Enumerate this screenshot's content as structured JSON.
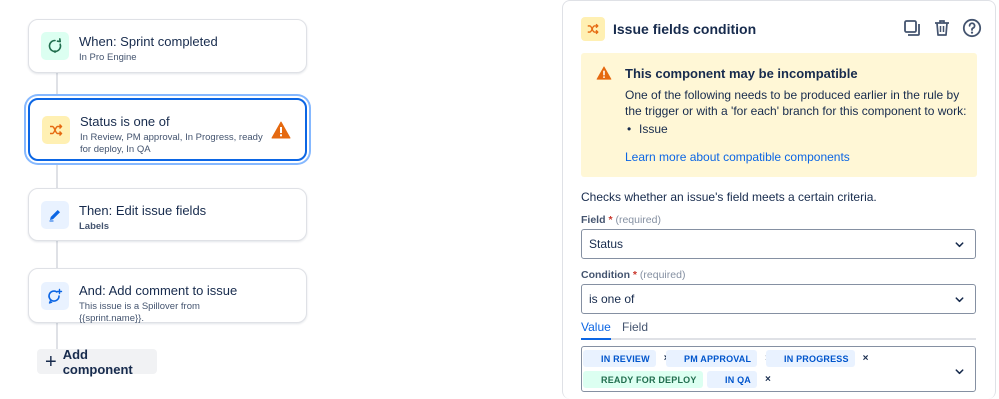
{
  "flow": {
    "trigger": {
      "title": "When: Sprint completed",
      "subtitle": "In Pro Engine",
      "icon": "sprint-refresh-icon"
    },
    "condition": {
      "title": "Status is one of",
      "subtitle": "In Review, PM approval, In Progress, ready for deploy, In QA",
      "icon": "shuffle-icon",
      "warning_icon": "warning-icon"
    },
    "action1": {
      "title": "Then: Edit issue fields",
      "subtitle": "Labels",
      "icon": "pencil-icon"
    },
    "action2": {
      "title": "And: Add comment to issue",
      "subtitle": "This issue is a Spillover from {{sprint.name}}.",
      "icon": "comment-add-icon"
    },
    "add_button": "Add component"
  },
  "panel": {
    "title": "Issue fields condition",
    "warning": {
      "title": "This component may be incompatible",
      "body": "One of the following needs to be produced earlier in the rule by the trigger or with a 'for each' branch for this component to work:",
      "bullet": "Issue",
      "link": "Learn more about compatible components"
    },
    "description": "Checks whether an issue's field meets a certain criteria.",
    "field": {
      "label": "Field",
      "required_mark": "*",
      "hint": "(required)",
      "value": "Status"
    },
    "condition": {
      "label": "Condition",
      "required_mark": "*",
      "hint": "(required)",
      "value": "is one of"
    },
    "tabs": {
      "value": "Value",
      "field": "Field"
    },
    "values": [
      "IN REVIEW",
      "PM APPROVAL",
      "IN PROGRESS",
      "READY FOR DEPLOY",
      "IN QA"
    ],
    "tag_x": "×"
  },
  "colors": {
    "accent": "#0c66e4",
    "warning_bg": "#fff7d6",
    "warning_icon": "#e56910",
    "tag_blue_bg": "#e9f2ff",
    "tag_green_bg": "#dcfff1"
  }
}
